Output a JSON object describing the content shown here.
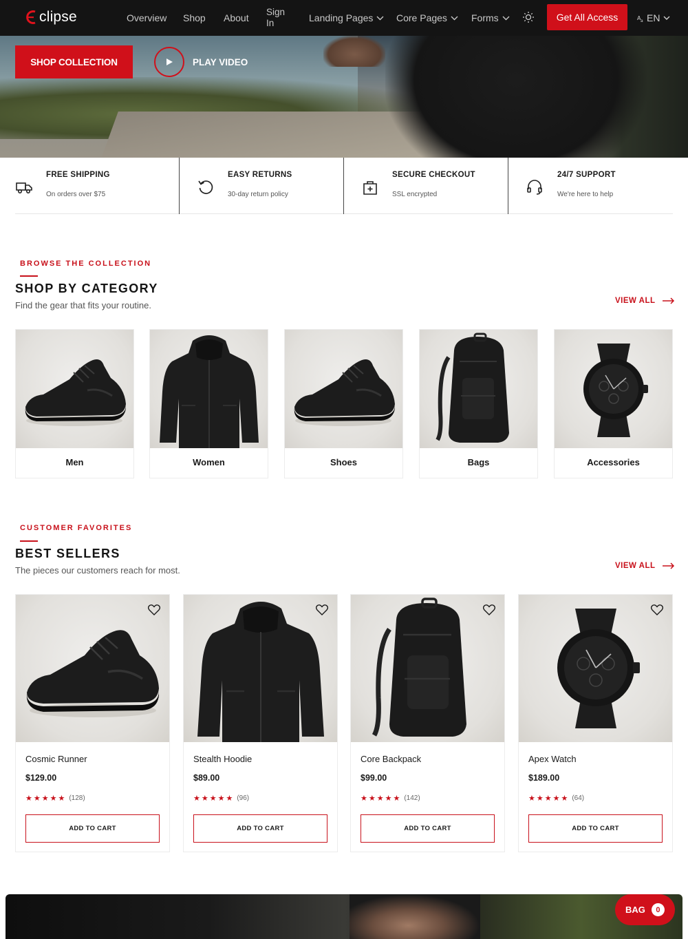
{
  "nav": {
    "logo_text": "clipse",
    "links": [
      "Overview",
      "Shop",
      "About"
    ],
    "sign_in": "Sign In",
    "dropdowns": [
      "Landing Pages",
      "Core Pages",
      "Forms"
    ],
    "cta": "Get All Access",
    "language": "EN"
  },
  "hero": {
    "shop_button": "SHOP COLLECTION",
    "play_button": "PLAY VIDEO"
  },
  "features": [
    {
      "icon": "truck-icon",
      "title": "FREE SHIPPING",
      "subtitle": "On orders over $75"
    },
    {
      "icon": "refresh-icon",
      "title": "EASY RETURNS",
      "subtitle": "30-day return policy"
    },
    {
      "icon": "secure-bag-icon",
      "title": "SECURE CHECKOUT",
      "subtitle": "SSL encrypted"
    },
    {
      "icon": "headset-icon",
      "title": "24/7 SUPPORT",
      "subtitle": "We're here to help"
    }
  ],
  "categories_section": {
    "eyebrow": "BROWSE THE COLLECTION",
    "title": "SHOP BY CATEGORY",
    "subtitle": "Find the gear that fits your routine.",
    "view_all": "VIEW ALL",
    "items": [
      {
        "label": "Men",
        "image": "sneaker-icon"
      },
      {
        "label": "Women",
        "image": "hoodie-icon"
      },
      {
        "label": "Shoes",
        "image": "sneaker-icon"
      },
      {
        "label": "Bags",
        "image": "backpack-icon"
      },
      {
        "label": "Accessories",
        "image": "watch-icon"
      }
    ]
  },
  "bestsellers_section": {
    "eyebrow": "CUSTOMER FAVORITES",
    "title": "BEST SELLERS",
    "subtitle": "The pieces our customers reach for most.",
    "view_all": "VIEW ALL",
    "products": [
      {
        "name": "Cosmic Runner",
        "price": "$129.00",
        "stars": "★★★★★",
        "reviews": "(128)",
        "button": "ADD TO CART",
        "image": "sneaker-icon"
      },
      {
        "name": "Stealth Hoodie",
        "price": "$89.00",
        "stars": "★★★★★",
        "reviews": "(96)",
        "button": "ADD TO CART",
        "image": "hoodie-icon"
      },
      {
        "name": "Core Backpack",
        "price": "$99.00",
        "stars": "★★★★★",
        "reviews": "(142)",
        "button": "ADD TO CART",
        "image": "backpack-icon"
      },
      {
        "name": "Apex Watch",
        "price": "$189.00",
        "stars": "★★★★★",
        "reviews": "(64)",
        "button": "ADD TO CART",
        "image": "watch-icon"
      }
    ]
  },
  "bag": {
    "label": "BAG",
    "count": "0"
  },
  "colors": {
    "accent": "#d0101a",
    "nav_bg": "#141414",
    "text": "#1a1a1a"
  }
}
